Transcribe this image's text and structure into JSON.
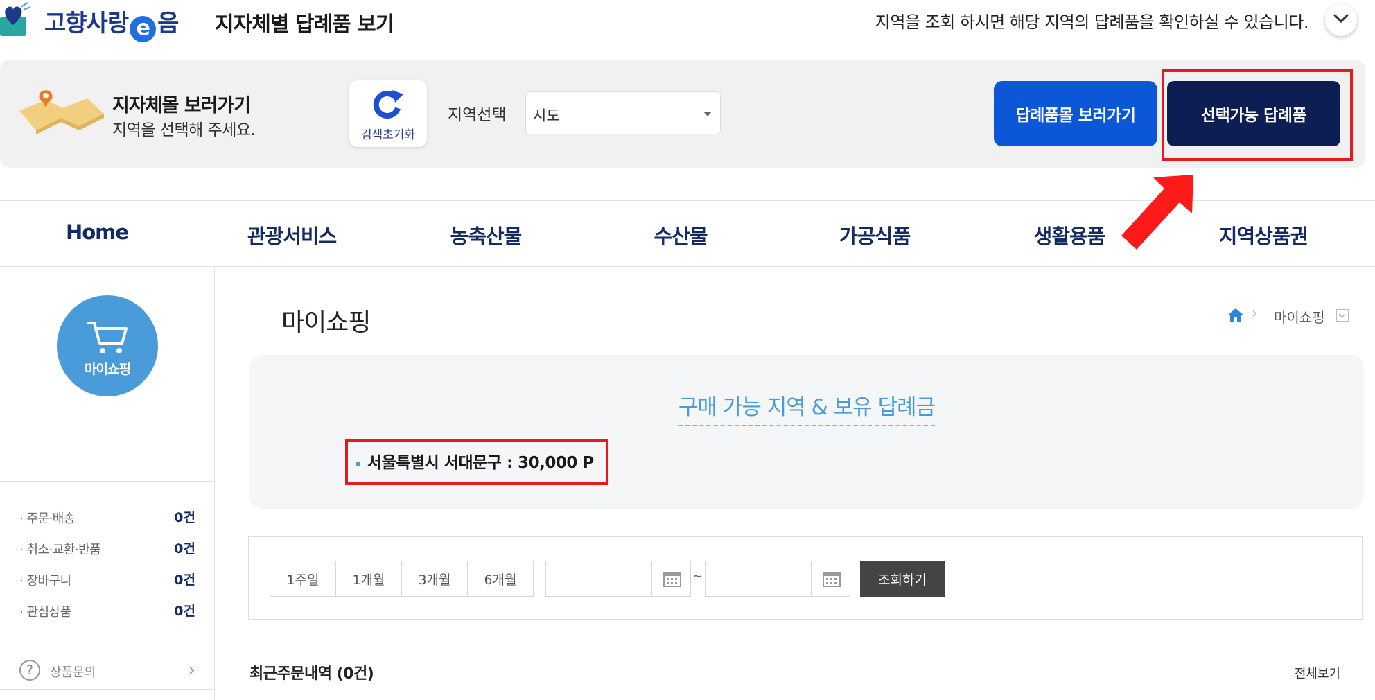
{
  "header": {
    "brand": {
      "before": "고향사랑",
      "e": "e",
      "after": "음"
    },
    "subtitle": "지자체별 답례품 보기",
    "notice": "지역을 조회 하시면 해당 지역의 답례품을 확인하실 수 있습니다.",
    "toggle_icon": "chevron-down-icon"
  },
  "region_panel": {
    "title": "지자체몰 보러가기",
    "desc": "지역을 선택해 주세요.",
    "reset_label": "검색초기화",
    "region_label": "지역선택",
    "select_value": "시도",
    "btn_gift_mall": "답례품몰 보러가기",
    "btn_available": "선택가능 답례품"
  },
  "nav": {
    "items": [
      "Home",
      "관광서비스",
      "농축산물",
      "수산물",
      "가공식품",
      "생활용품",
      "지역상품권"
    ]
  },
  "sidebar": {
    "circle_label": "마이쇼핑",
    "items": [
      {
        "label": "주문·배송",
        "count": "0건"
      },
      {
        "label": "취소·교환·반품",
        "count": "0건"
      },
      {
        "label": "장바구니",
        "count": "0건"
      },
      {
        "label": "관심상품",
        "count": "0건"
      }
    ],
    "inquiry_label": "상품문의",
    "inquiry_q": "?",
    "inquiry_chev": "›"
  },
  "content": {
    "page_title": "마이쇼핑",
    "breadcrumb": {
      "sep": "›",
      "current": "마이쇼핑"
    },
    "balance_title": "구매 가능 지역 & 보유 답례금",
    "balance_line": "서울특별시 서대문구 : 30,000 P",
    "periods": [
      "1주일",
      "1개월",
      "3개월",
      "6개월"
    ],
    "tilde": "~",
    "search_btn": "조회하기",
    "recent_title": "최근주문내역 (0건)",
    "viewall_btn": "전체보기"
  },
  "colors": {
    "brand_blue": "#1d3a8a",
    "primary_button": "#0b57d8",
    "dark_button": "#0d1f52",
    "highlight_red": "#e41b1b",
    "sidebar_circle": "#4a9bd9"
  }
}
